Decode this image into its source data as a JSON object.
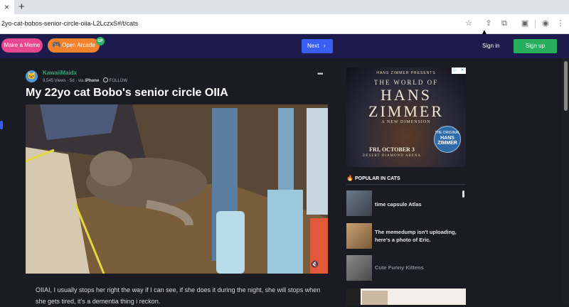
{
  "browser": {
    "tab_close": "×",
    "new_tab": "+",
    "url": "2yo-cat-bobos-senior-circle-oiia-L2LczxS#/t/cats",
    "icons": [
      "bookmark-star-icon",
      "share-icon",
      "extensions-icon",
      "tab-search-icon",
      "profile-icon",
      "menu-icon"
    ]
  },
  "header": {
    "make_meme": "Make a Meme",
    "open_arcade": "Open Arcade",
    "arcade_badge": "GP",
    "next": "Next",
    "sign_in": "Sign in",
    "sign_up": "Sign up",
    "colors": {
      "bar": "#1c1b4c",
      "meme": "#e84790",
      "arcade": "#f2832c",
      "next": "#3a5df2",
      "signup": "#27ad5b"
    }
  },
  "post": {
    "username": "KawaiiMaidx",
    "views": "9,545 Views",
    "age": "5d",
    "via_prefix": "via",
    "device": "iPhone",
    "follow": "FOLLOW",
    "more": "•••",
    "title": "My 22yo cat Bobo's senior circle OIIA",
    "caption": "OIIAI, I usually stops her right the way if I can see, if she does it during the night, she will stops when she gets tired, it's a dementia thing i reckon.",
    "mute_icon": "speaker-muted-icon"
  },
  "ad": {
    "presents": "HANS ZIMMER PRESENTS",
    "world": "THE WORLD OF",
    "name1": "HANS",
    "name2": "ZIMMER",
    "dimension": "A NEW DIMENSION",
    "date": "FRI, OCTOBER 3",
    "venue": "DESERT DIAMOND ARENA",
    "badge_top": "THE ORIGINAL",
    "badge_name": "HANS ZIMMER"
  },
  "sidebar": {
    "popular_heading": "POPULAR IN CATS",
    "items": [
      {
        "label": "time capsule Atlas"
      },
      {
        "label": "The memedump isn't uploading, here's a photo of Eric."
      },
      {
        "label": "Cute Funny Kittens"
      }
    ]
  }
}
